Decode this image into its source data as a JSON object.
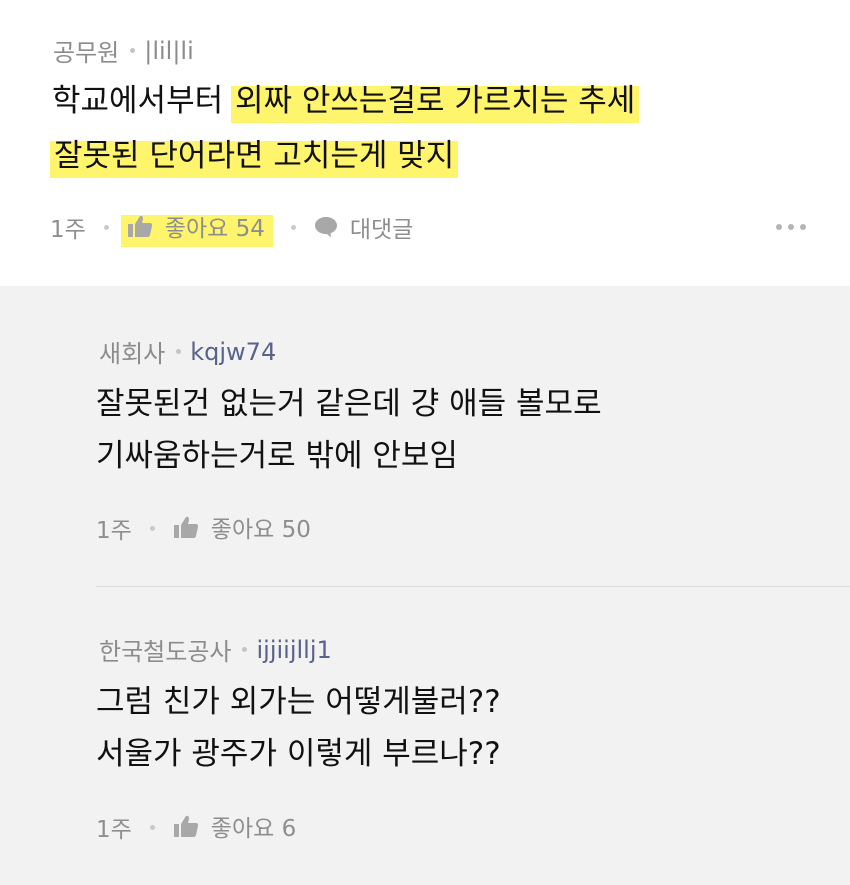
{
  "comments": [
    {
      "author": "공무원",
      "user_id": "|lil|li",
      "lines": [
        "학교에서부터",
        "외짜 안쓰는걸로 가르치는 추세",
        "잘못된 단어라면 고치는게 맞지"
      ],
      "time": "1주",
      "like_label": "좋아요 54",
      "reply_label": "대댓글"
    }
  ],
  "replies": [
    {
      "author": "새회사",
      "user_id": "kqjw74",
      "lines": [
        "잘못된건 없는거 같은데 걍 애들 볼모로",
        "기싸움하는거로 밖에 안보임"
      ],
      "time": "1주",
      "like_label": "좋아요 50"
    },
    {
      "author": "한국철도공사",
      "user_id": "ijjiijllj1",
      "lines": [
        "그럼 친가 외가는 어떻게불러??",
        "서울가 광주가 이렇게 부르나??"
      ],
      "time": "1주",
      "like_label": "좋아요 6"
    }
  ],
  "colors": {
    "highlight": "#fff56d",
    "reply_background": "#f2f2f2",
    "user_id": "#59628a"
  },
  "icons": [
    "thumbs-up-icon",
    "speech-bubble-icon",
    "more-dots-icon"
  ]
}
